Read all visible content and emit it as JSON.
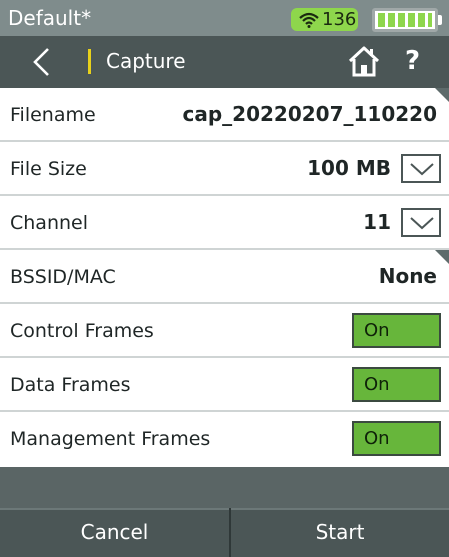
{
  "status_bar": {
    "profile_name": "Default*",
    "wifi_count": "136",
    "wifi_icon": "wifi-icon",
    "battery_icon": "battery-icon",
    "battery_level": 1.0,
    "colors": {
      "background": "#7f8c8c",
      "badge": "#8ed64c"
    }
  },
  "nav_bar": {
    "back_icon": "chevron-left-icon",
    "title": "Capture",
    "home_icon": "home-icon",
    "help_label": "?",
    "colors": {
      "background": "#4b5656",
      "divider": "#e8d11b"
    }
  },
  "rows": {
    "filename": {
      "label": "Filename",
      "value": "cap_20220207_110220"
    },
    "file_size": {
      "label": "File Size",
      "value": "100 MB",
      "control_icon": "chevron-down-icon"
    },
    "channel": {
      "label": "Channel",
      "value": "11",
      "control_icon": "chevron-down-icon"
    },
    "bssid": {
      "label": "BSSID/MAC",
      "value": "None"
    },
    "control_frames": {
      "label": "Control Frames",
      "toggle": "On"
    },
    "data_frames": {
      "label": "Data Frames",
      "toggle": "On"
    },
    "management_frames": {
      "label": "Management Frames",
      "toggle": "On"
    }
  },
  "toggle_color": "#67b63b",
  "buttons": {
    "cancel": "Cancel",
    "start": "Start"
  }
}
